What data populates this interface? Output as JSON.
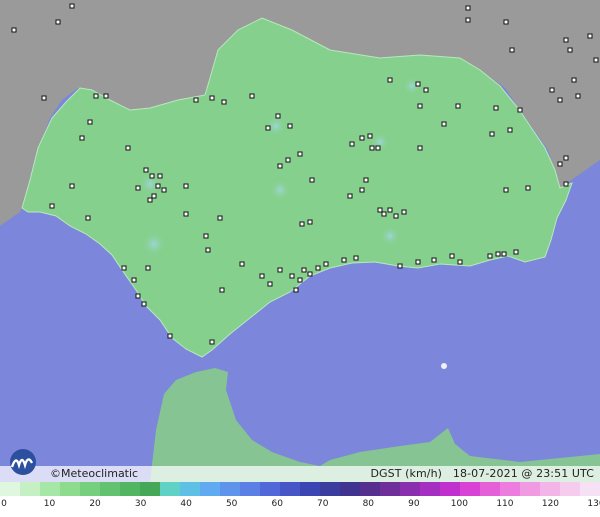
{
  "map": {
    "attribution": "©Meteoclimatic",
    "variable_label": "DGST (km/h)",
    "timestamp": "18-07-2021 @ 23:51 UTC",
    "colors": {
      "sea": "#7c86da",
      "land_region": "#86d08e",
      "land_outside": "#9a9a9a",
      "station_marker": "#111111"
    }
  },
  "legend": {
    "ticks": [
      "0",
      "10",
      "20",
      "30",
      "40",
      "50",
      "60",
      "70",
      "80",
      "90",
      "100",
      "110",
      "120",
      "130"
    ],
    "colors": [
      "#dff7df",
      "#c4f0c4",
      "#a6e6a6",
      "#8ddb8d",
      "#76cf7c",
      "#63c26f",
      "#52b561",
      "#45a858",
      "#5fd2c5",
      "#5fc0e6",
      "#5faaf0",
      "#5f94ec",
      "#5a7fe5",
      "#5168d8",
      "#4656c6",
      "#3c46b3",
      "#3a3c9e",
      "#40328f",
      "#55308f",
      "#6e2f9a",
      "#8a2fae",
      "#a52fc0",
      "#c12fcf",
      "#d843d6",
      "#e55fd9",
      "#ec7cdd",
      "#f09ae2",
      "#f3b5e8",
      "#f5ccee",
      "#f6e0f3"
    ]
  }
}
